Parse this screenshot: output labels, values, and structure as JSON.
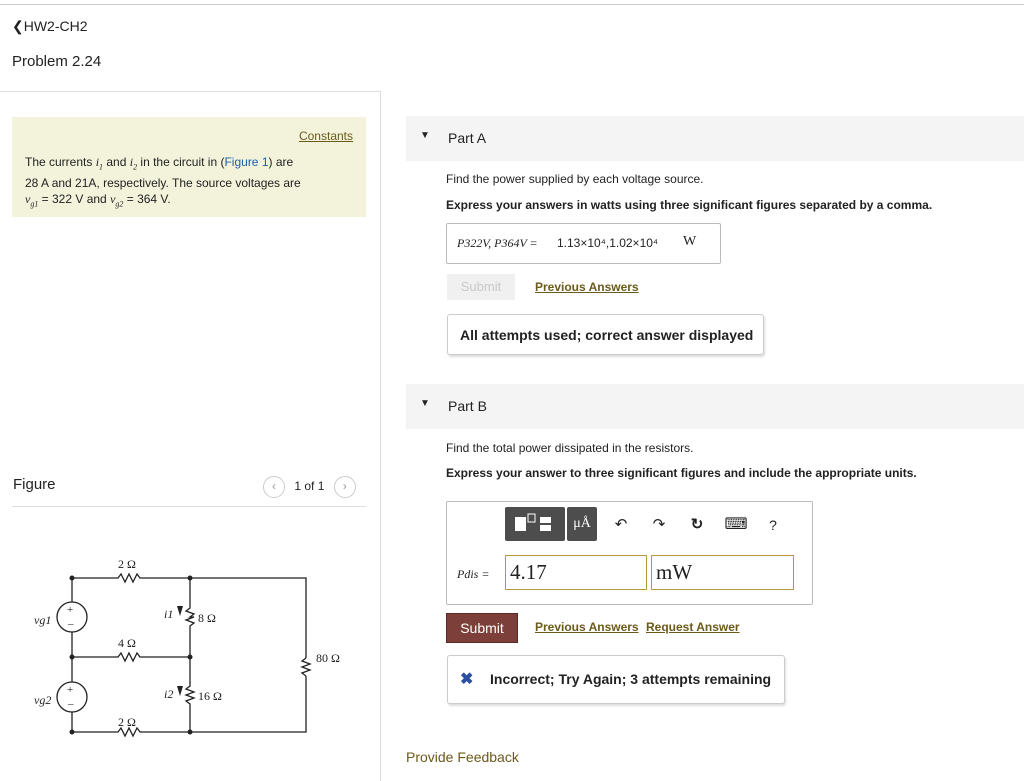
{
  "nav": {
    "back_label": "❮HW2-CH2",
    "problem_title": "Problem 2.24"
  },
  "intro": {
    "constants_label": "Constants",
    "line1a": "The currents ",
    "i1": "i",
    "line1b": " and ",
    "line1c": " in the circuit in (",
    "figure_link": "Figure 1",
    "line1d": ") are",
    "line2": "28 A and 21A, respectively. The source voltages are",
    "line3a": " = 322 V and ",
    "line3b": " = 364 V."
  },
  "figure": {
    "label": "Figure",
    "pager": "1 of 1",
    "prev_icon": "‹",
    "next_icon": "›"
  },
  "circuit": {
    "r_top": "2 Ω",
    "r_mid": "4 Ω",
    "r_bot": "2 Ω",
    "r_i1": "8 Ω",
    "r_i2": "16 Ω",
    "r_right": "80 Ω",
    "src1": "vg1",
    "src2": "vg2",
    "cur1": "i1",
    "cur2": "i2"
  },
  "partA": {
    "title": "Part A",
    "question": "Find the power supplied by each voltage source.",
    "instruction": "Express your answers in watts using three significant figures separated by a comma.",
    "answer_label": "P322V, P364V =",
    "answer_value": "1.13×10⁴,1.02×10⁴",
    "answer_unit": "W",
    "submit_label": "Submit",
    "prev_answers_label": "Previous Answers",
    "status_message": "All attempts used; correct answer displayed"
  },
  "partB": {
    "title": "Part B",
    "question": "Find the total power dissipated in the resistors.",
    "instruction": "Express your answer to three significant figures and include the appropriate units.",
    "toolbar": {
      "units_label": "μÅ",
      "undo": "↶",
      "redo": "↷",
      "reset": "↻",
      "keyboard": "⌨",
      "help": "?"
    },
    "answer_label": "Pdis =",
    "value": "4.17",
    "unit": "mW",
    "submit_label": "Submit",
    "prev_answers_label": "Previous Answers",
    "request_answer_label": "Request Answer",
    "status_icon": "✖",
    "status_message": "Incorrect; Try Again; 3 attempts remaining"
  },
  "footer": {
    "feedback_label": "Provide Feedback"
  }
}
